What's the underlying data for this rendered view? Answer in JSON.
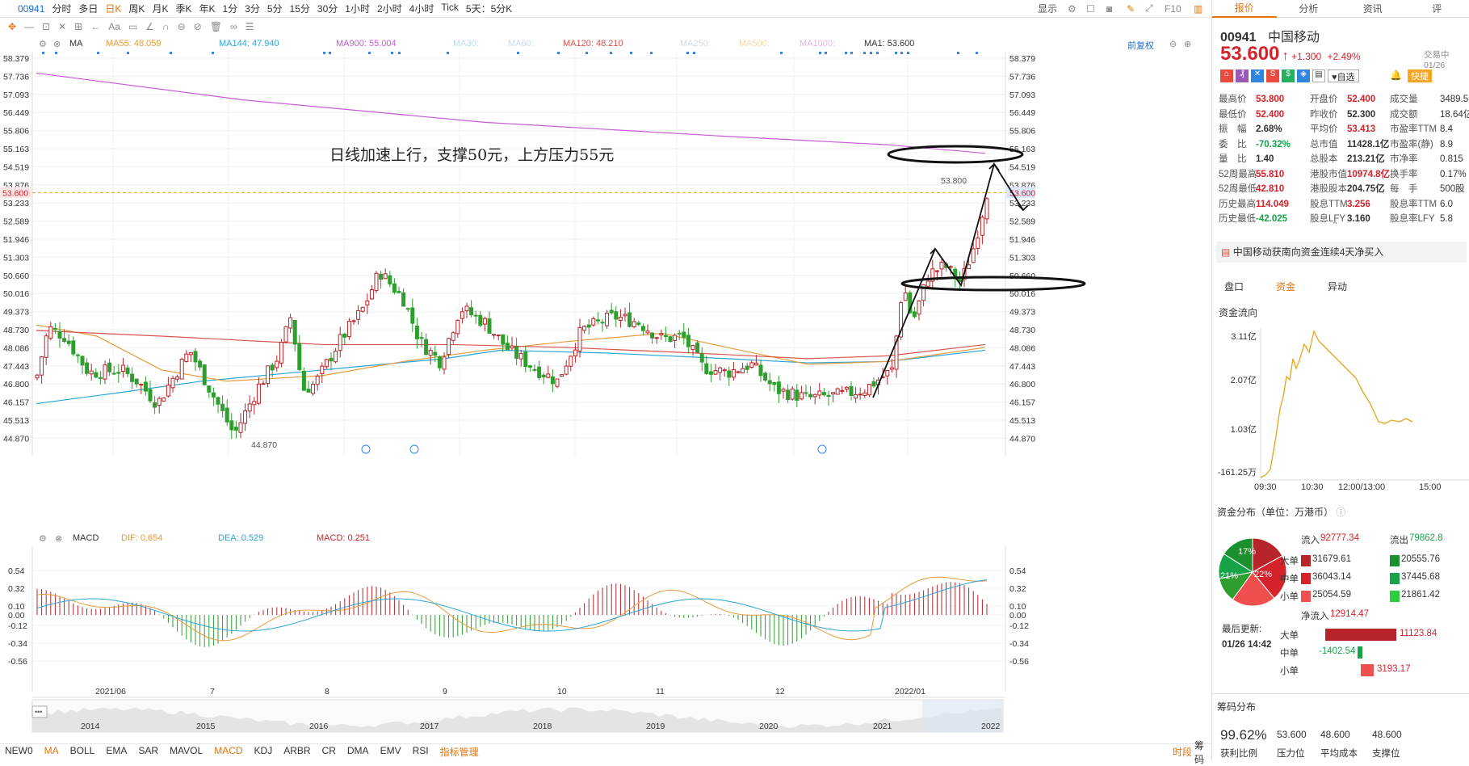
{
  "toolbar": {
    "code": "00941",
    "items": [
      "分时",
      "多日",
      "日K",
      "周K",
      "月K",
      "季K",
      "年K",
      "1分",
      "3分",
      "5分",
      "15分",
      "30分",
      "1小时",
      "2小时",
      "4小时",
      "Tick",
      "5天：5分K"
    ],
    "active": "日K",
    "display": "显示",
    "f10": "F10"
  },
  "ma_bar": {
    "label": "MA",
    "ma55": "MA55: 48.059",
    "ma144": "MA144: 47.940",
    "ma900": "MA900: 55.004",
    "ma30": "MA30:",
    "ma60": "MA60:",
    "ma120": "MA120: 48.210",
    "ma250": "MA250:",
    "ma500": "MA500:",
    "ma1000": "MA1000:",
    "ma1": "MA1: 53.600",
    "adjust": "前复权"
  },
  "y_ticks": [
    "58.379",
    "57.736",
    "57.093",
    "56.449",
    "55.806",
    "55.163",
    "54.519",
    "53.876",
    "53.233",
    "52.589",
    "51.946",
    "51.303",
    "50.660",
    "50.016",
    "49.373",
    "48.730",
    "48.086",
    "47.443",
    "46.800",
    "46.157",
    "45.513",
    "44.870"
  ],
  "current_price": "53.600",
  "annotation": "日线加速上行，支撑50元，上方压力55元",
  "high_label": "53.800",
  "low_label": "44.870",
  "macd_bar": {
    "label": "MACD",
    "dif": "DIF: 0.654",
    "dea": "DEA: 0.529",
    "macd": "MACD: 0.251"
  },
  "macd_ticks": [
    "0.54",
    "0.32",
    "0.10",
    "0.00",
    "-0.12",
    "-0.34",
    "-0.56"
  ],
  "x_labels": [
    "2021/06",
    "7",
    "8",
    "9",
    "10",
    "11",
    "12",
    "2022/01"
  ],
  "overview_years": [
    "2014",
    "2015",
    "2016",
    "2017",
    "2018",
    "2019",
    "2020",
    "2021",
    "2022"
  ],
  "bottom_tabs": [
    "NEW0",
    "MA",
    "BOLL",
    "EMA",
    "SAR",
    "MAVOL",
    "MACD",
    "KDJ",
    "ARBR",
    "CR",
    "DMA",
    "EMV",
    "RSI",
    "指标管理"
  ],
  "bottom_right": [
    "时段",
    "筹码"
  ],
  "right": {
    "tabs": [
      "报价",
      "分析",
      "资讯",
      "评"
    ],
    "code": "00941",
    "name": "中国移动",
    "price": "53.600",
    "change": "+1.300",
    "pct": "+2.49%",
    "status": "交易中 01/26",
    "fav": "自选",
    "fast": "快捷",
    "quote": [
      [
        "最高价",
        "53.800",
        "开盘价",
        "52.400",
        "成交量",
        "3489.5"
      ],
      [
        "最低价",
        "52.400",
        "昨收价",
        "52.300",
        "成交额",
        "18.64亿"
      ],
      [
        "振　幅",
        "2.68%",
        "平均价",
        "53.413",
        "市盈率TTM",
        "8.4"
      ],
      [
        "委　比",
        "-70.32%",
        "总市值",
        "11428.1亿",
        "市盈率(静)",
        "8.9"
      ],
      [
        "量　比",
        "1.40",
        "总股本",
        "213.21亿",
        "市净率",
        "0.815"
      ],
      [
        "52周最高",
        "55.810",
        "港股市值",
        "10974.8亿",
        "换手率",
        "0.17%"
      ],
      [
        "52周最低",
        "42.810",
        "港股股本",
        "204.75亿",
        "每　手",
        "500股"
      ],
      [
        "历史最高",
        "114.049",
        "股息TTM",
        "3.256",
        "股息率TTM",
        "6.0"
      ],
      [
        "历史最低",
        "-42.025",
        "股息LFY",
        "3.160",
        "股息率LFY",
        "5.8"
      ]
    ],
    "news": "中国移动获南向资金连续4天净买入",
    "subtabs": [
      "盘口",
      "资金",
      "异动"
    ],
    "flow_title": "资金流向",
    "flow_y": [
      "3.11亿",
      "2.07亿",
      "1.03亿",
      "-161.25万"
    ],
    "flow_x": [
      "09:30",
      "10:30",
      "12:00/13:00",
      "15:00"
    ],
    "dist_title": "资金分布（单位：万港币）",
    "pie": [
      "17%",
      "22%",
      "21%"
    ],
    "in_label": "流入",
    "in_total": "92777.34",
    "out_label": "流出",
    "out_total": "79862.8",
    "rows": [
      [
        "大单",
        "31679.61",
        "20555.76"
      ],
      [
        "中单",
        "36043.14",
        "37445.68"
      ],
      [
        "小单",
        "25054.59",
        "21861.42"
      ]
    ],
    "update_label": "最后更新:",
    "update_time": "01/26 14:42",
    "net_label": "净流入",
    "net_total": "12914.47",
    "net_rows": [
      [
        "大单",
        "11123.84"
      ],
      [
        "中单",
        "-1402.54"
      ],
      [
        "小单",
        "3193.17"
      ]
    ],
    "chip_title": "筹码分布",
    "chip": [
      [
        "99.62%",
        "获利比例"
      ],
      [
        "53.600",
        "压力位"
      ],
      [
        "48.600",
        "平均成本"
      ],
      [
        "48.600",
        "支撑位"
      ]
    ]
  }
}
